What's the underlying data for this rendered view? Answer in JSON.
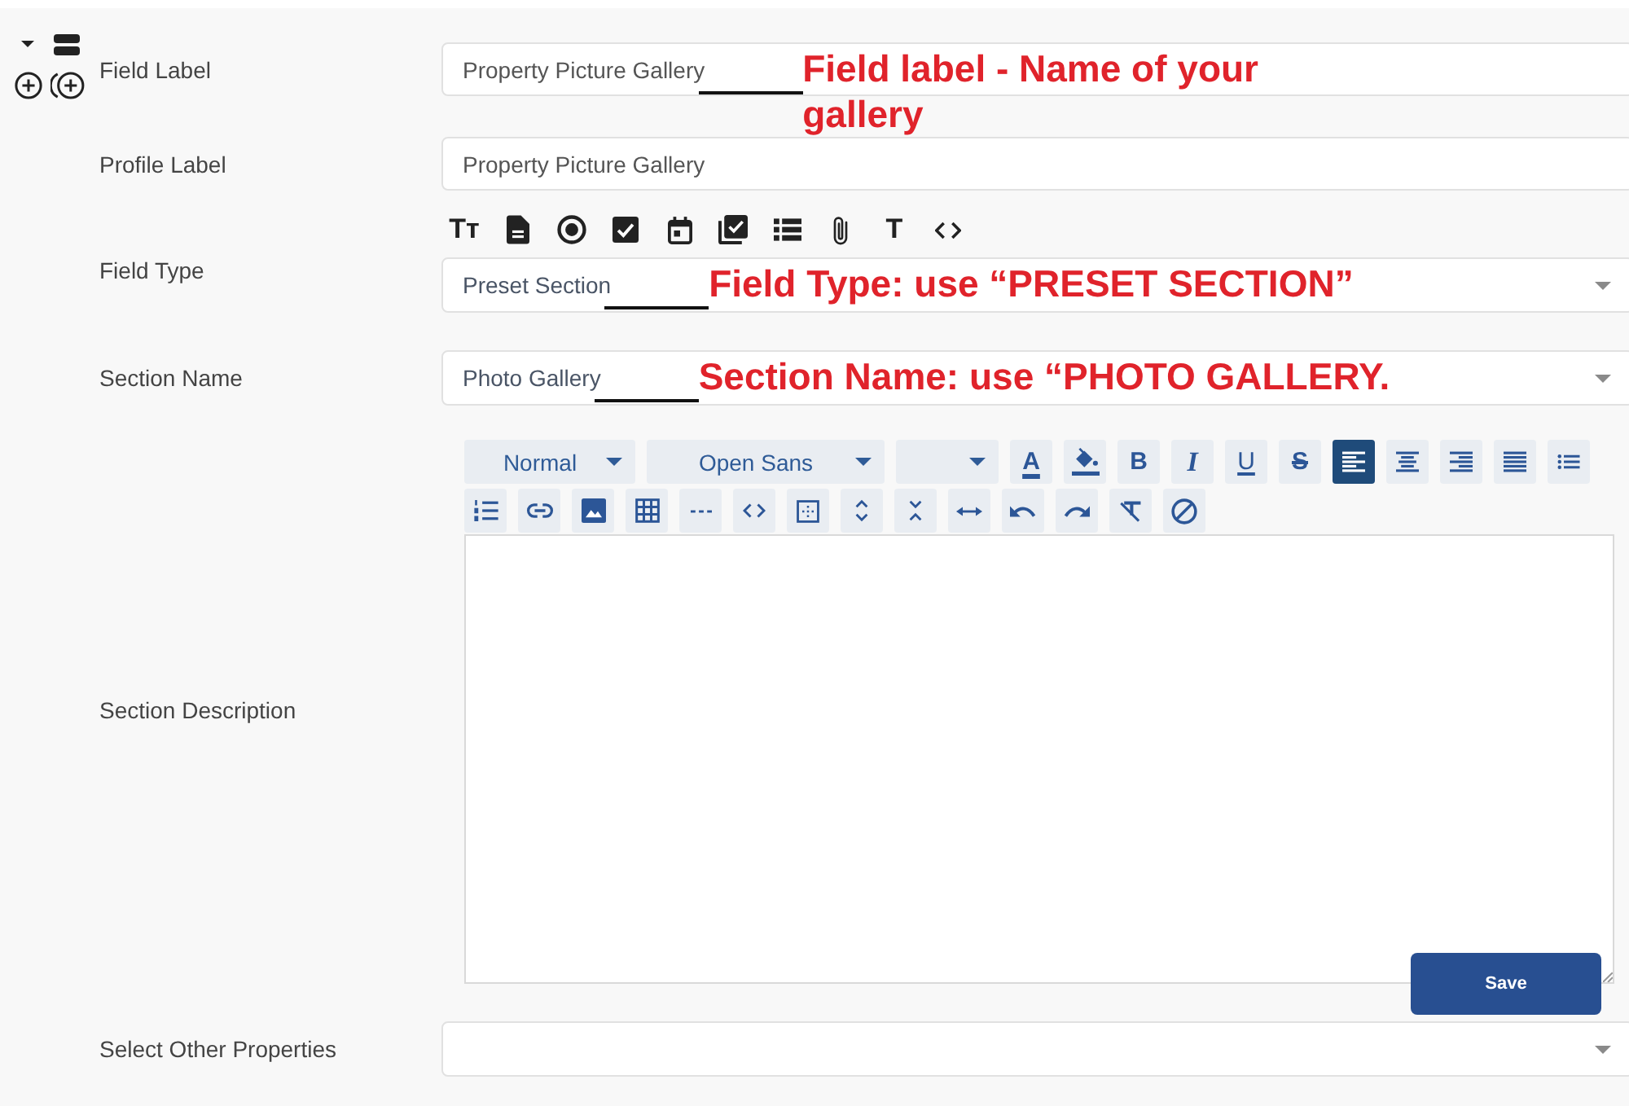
{
  "rows": [
    {
      "kind": "text",
      "label": "Field Label",
      "value": "Property Picture Gallery",
      "annotation": "Field label - Name of your\ngallery"
    },
    {
      "kind": "text",
      "label": "Profile Label",
      "value": "Property Picture Gallery"
    },
    {
      "kind": "select",
      "label": "Field Type",
      "tools": [
        {
          "kind": "glyph",
          "text": "Tт"
        },
        {
          "kind": "document"
        },
        {
          "kind": "radio"
        },
        {
          "kind": "checkbox"
        },
        {
          "kind": "calendar"
        },
        {
          "kind": "checklist"
        },
        {
          "kind": "list"
        },
        {
          "kind": "attachment"
        },
        {
          "kind": "glyph",
          "text": "T"
        },
        {
          "kind": "code"
        }
      ],
      "value": "Preset Section",
      "annotation": "Field Type: use “PRESET SECTION”"
    },
    {
      "kind": "select",
      "label": "Section Name",
      "value": "Photo Gallery",
      "annotation": "Section Name: use “PHOTO GALLERY."
    },
    {
      "kind": "editor",
      "label": "Section Description",
      "toolbar": [
        {
          "kind": "dropdown",
          "value": "Normal"
        },
        {
          "kind": "dropdown",
          "value": "Open Sans"
        },
        {
          "kind": "dropdown"
        },
        {
          "kind": "color",
          "text": "A",
          "selected": false
        },
        {
          "kind": "fill",
          "selected": false
        },
        {
          "kind": "bold",
          "text": "B",
          "selected": false
        },
        {
          "kind": "italic",
          "text": "I",
          "selected": false
        },
        {
          "kind": "underline",
          "text": "U",
          "selected": false
        },
        {
          "kind": "strike",
          "text": "S",
          "selected": false
        },
        {
          "kind": "left",
          "selected": true
        },
        {
          "kind": "center",
          "selected": false
        },
        {
          "kind": "right",
          "selected": false
        },
        {
          "kind": "justify",
          "selected": false
        },
        {
          "kind": "bullets",
          "selected": false
        },
        {
          "kind": "numbers",
          "selected": false
        },
        {
          "kind": "link",
          "selected": false
        },
        {
          "kind": "image",
          "selected": false
        },
        {
          "kind": "table",
          "selected": false
        },
        {
          "kind": "rule",
          "selected": false
        },
        {
          "kind": "code",
          "selected": false
        },
        {
          "kind": "blocks",
          "selected": false
        },
        {
          "kind": "expand",
          "selected": false
        },
        {
          "kind": "collapse",
          "selected": false
        },
        {
          "kind": "width",
          "selected": false
        },
        {
          "kind": "undo",
          "selected": false
        },
        {
          "kind": "redo",
          "selected": false
        },
        {
          "kind": "clear",
          "selected": false
        },
        {
          "kind": "none",
          "selected": false
        }
      ],
      "button": "Save"
    },
    {
      "kind": "select",
      "label": "Select Other Properties"
    }
  ]
}
